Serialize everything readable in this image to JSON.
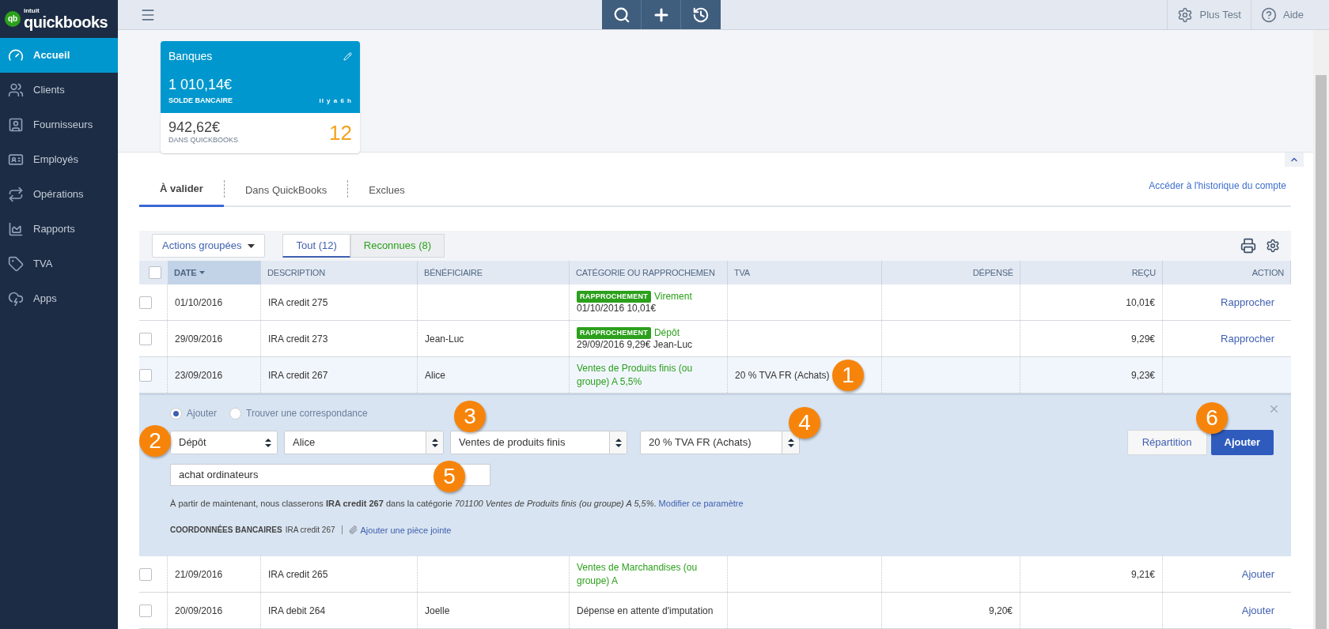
{
  "logo": {
    "mark": "qb",
    "brand": "intuit",
    "name": "quickbooks"
  },
  "sidebar": {
    "items": [
      {
        "label": "Accueil",
        "selected": true
      },
      {
        "label": "Clients",
        "selected": false
      },
      {
        "label": "Fournisseurs",
        "selected": false
      },
      {
        "label": "Employés",
        "selected": false
      },
      {
        "label": "Opérations",
        "selected": false
      },
      {
        "label": "Rapports",
        "selected": false
      },
      {
        "label": "TVA",
        "selected": false
      },
      {
        "label": "Apps",
        "selected": false
      }
    ]
  },
  "topbar": {
    "company": "Plus Test",
    "help": "Aide"
  },
  "bank_card": {
    "title": "Banques",
    "bank_balance": "1 010,14€",
    "bank_balance_label": "SOLDE BANCAIRE",
    "updated": "Il y a 6 h",
    "qb_balance": "942,62€",
    "qb_balance_label": "DANS QUICKBOOKS",
    "pending_count": "12"
  },
  "tabs": [
    {
      "label": "À valider",
      "selected": true
    },
    {
      "label": "Dans QuickBooks",
      "selected": false
    },
    {
      "label": "Exclues",
      "selected": false
    }
  ],
  "history_link": "Accéder à l'historique du compte",
  "toolbar": {
    "batch_actions": "Actions groupées",
    "filters": [
      {
        "label": "Tout (12)",
        "selected": true,
        "kind": "all"
      },
      {
        "label": "Reconnues (8)",
        "selected": false,
        "kind": "recognized"
      }
    ]
  },
  "table": {
    "select_all": {
      "checked": false
    },
    "columns": [
      {
        "label": "DATE",
        "sorted": true
      },
      {
        "label": "DESCRIPTION",
        "sorted": false
      },
      {
        "label": "BÉNÉFICIAIRE",
        "sorted": false
      },
      {
        "label": "CATÉGORIE OU RAPPROCHEMEN",
        "sorted": false
      },
      {
        "label": "TVA",
        "sorted": false
      },
      {
        "label": "DÉPENSÉ",
        "sorted": false
      },
      {
        "label": "REÇU",
        "sorted": false
      },
      {
        "label": "ACTION",
        "sorted": false
      }
    ],
    "rows": [
      {
        "checked": false,
        "selected": false,
        "date": "01/10/2016",
        "description": "IRA credit 275",
        "payee": "",
        "category": {
          "kind": "match",
          "badge": "RAPPROCHEMENT",
          "name": "Virement",
          "detail": "01/10/2016 10,01€"
        },
        "tva": "",
        "spent": "",
        "received": "10,01€",
        "action": "Rapprocher"
      },
      {
        "checked": false,
        "selected": false,
        "date": "29/09/2016",
        "description": "IRA credit 273",
        "payee": "Jean-Luc",
        "category": {
          "kind": "match",
          "badge": "RAPPROCHEMENT",
          "name": "Dépôt",
          "detail": "29/09/2016 9,29€ Jean-Luc"
        },
        "tva": "",
        "spent": "",
        "received": "9,29€",
        "action": "Rapprocher"
      },
      {
        "checked": false,
        "selected": true,
        "date": "23/09/2016",
        "description": "IRA credit 267",
        "payee": "Alice",
        "category": {
          "kind": "suggested",
          "name": "Ventes de Produits finis (ou groupe) A 5,5%"
        },
        "tva": "20 % TVA FR (Achats)",
        "spent": "",
        "received": "9,23€",
        "action": "",
        "editor": {
          "mode_options": [
            {
              "label": "Ajouter",
              "selected": true
            },
            {
              "label": "Trouver une correspondance",
              "selected": false
            }
          ],
          "type_select": "Dépôt",
          "payee_select": "Alice",
          "category_select": "Ventes de produits finis",
          "tax_select": "20 % TVA FR (Achats)",
          "memo": "achat ordinateurs",
          "rule_text": "À partir de maintenant, nous classerons **IRA credit 267** dans la catégorie *701100 Ventes de Produits finis (ou groupe) A 5,5%*.",
          "rule_link": "Modifier ce paramètre",
          "bank_details_label": "COORDONNÉES BANCAIRES",
          "bank_details_value": "IRA credit 267",
          "attach_link": "Ajouter une pièce jointe",
          "split_button": "Répartition",
          "add_button": "Ajouter"
        }
      },
      {
        "checked": false,
        "selected": false,
        "date": "21/09/2016",
        "description": "IRA credit 265",
        "payee": "",
        "category": {
          "kind": "suggested",
          "name": "Ventes de Marchandises (ou groupe) A"
        },
        "tva": "",
        "spent": "",
        "received": "9,21€",
        "action": "Ajouter"
      },
      {
        "checked": false,
        "selected": false,
        "date": "20/09/2016",
        "description": "IRA debit 264",
        "payee": "Joelle",
        "category": {
          "kind": "plain",
          "name": "Dépense en attente d'imputation"
        },
        "tva": "",
        "spent": "9,20€",
        "received": "",
        "action": "Ajouter"
      }
    ]
  },
  "callouts": [
    {
      "label": "1"
    },
    {
      "label": "2"
    },
    {
      "label": "3"
    },
    {
      "label": "4"
    },
    {
      "label": "5"
    },
    {
      "label": "6"
    }
  ]
}
